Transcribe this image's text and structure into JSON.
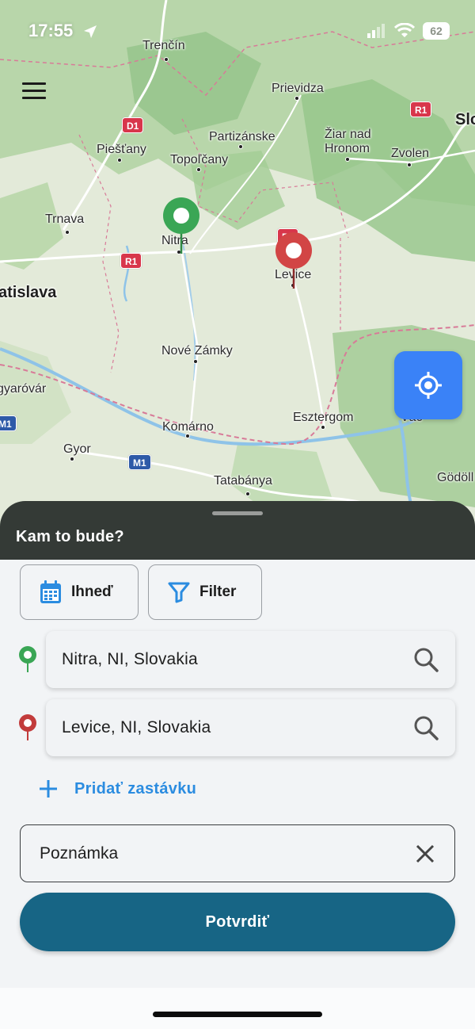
{
  "status_bar": {
    "time": "17:55",
    "battery": "62"
  },
  "map": {
    "cities": [
      {
        "name": "Trenčín"
      },
      {
        "name": "Prievidza"
      },
      {
        "name": "Partizánske"
      },
      {
        "name": "Piešťany"
      },
      {
        "name": "Topoľčany"
      },
      {
        "name": "Žiar nad"
      },
      {
        "name": "Hronom"
      },
      {
        "name": "Zvolen"
      },
      {
        "name": "Trnava"
      },
      {
        "name": "Nitra"
      },
      {
        "name": "Levice"
      },
      {
        "name": "atislava"
      },
      {
        "name": "Nové Zámky"
      },
      {
        "name": "gyaróvár"
      },
      {
        "name": "Esztergom"
      },
      {
        "name": "Komárno"
      },
      {
        "name": "Gyor"
      },
      {
        "name": "Tatabánya"
      },
      {
        "name": "Vác"
      },
      {
        "name": "Gödöll"
      },
      {
        "name": "Slo"
      }
    ],
    "road_shields": [
      "D1",
      "R1",
      "R1",
      "R1",
      "M1",
      "M1"
    ],
    "colors": {
      "start_pin": "#3aa655",
      "end_pin": "#d24545"
    }
  },
  "sheet": {
    "title": "Kam to bude?",
    "time_chip": "Ihneď",
    "filter_chip": "Filter",
    "origin": "Nitra, NI, Slovakia",
    "destination": "Levice, NI, Slovakia",
    "add_stop": "Pridať zastávku",
    "note": "Poznámka",
    "confirm": "Potvrdiť"
  },
  "colors": {
    "accent": "#2b8ce0",
    "confirm": "#176585",
    "header": "#343a36",
    "locate": "#3a82f7"
  }
}
